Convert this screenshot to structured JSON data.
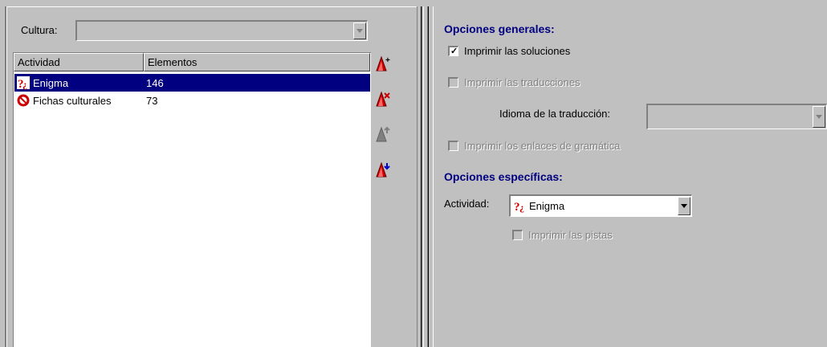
{
  "left": {
    "culture_label": "Cultura:",
    "culture_value": "",
    "columns": [
      "Actividad",
      "Elementos"
    ],
    "rows": [
      {
        "name": "Enigma",
        "count": "146",
        "selected": true,
        "icon": "enigma-icon"
      },
      {
        "name": "Fichas culturales",
        "count": "73",
        "selected": false,
        "icon": "no-entry-icon"
      }
    ],
    "tools": [
      "add-activity-icon",
      "remove-activity-icon",
      "move-up-icon",
      "move-down-icon"
    ]
  },
  "right": {
    "general_title": "Opciones generales:",
    "print_solutions": {
      "label": "Imprimir las soluciones",
      "checked": true,
      "enabled": true
    },
    "print_translations": {
      "label": "Imprimir las traducciones",
      "checked": false,
      "enabled": false
    },
    "translation_language_label": "Idioma de la traducción:",
    "translation_language_value": "",
    "print_grammar_links": {
      "label": "Imprimir los enlaces de gramática",
      "checked": false,
      "enabled": false
    },
    "specific_title": "Opciones específicas:",
    "activity_label": "Actividad:",
    "activity_value": "Enigma",
    "print_hints": {
      "label": "Imprimir las pistas",
      "checked": false,
      "enabled": false
    }
  },
  "colors": {
    "selection": "#000080",
    "section_title": "#000080",
    "icon_red": "#cc0000",
    "face": "#c0c0c0"
  }
}
